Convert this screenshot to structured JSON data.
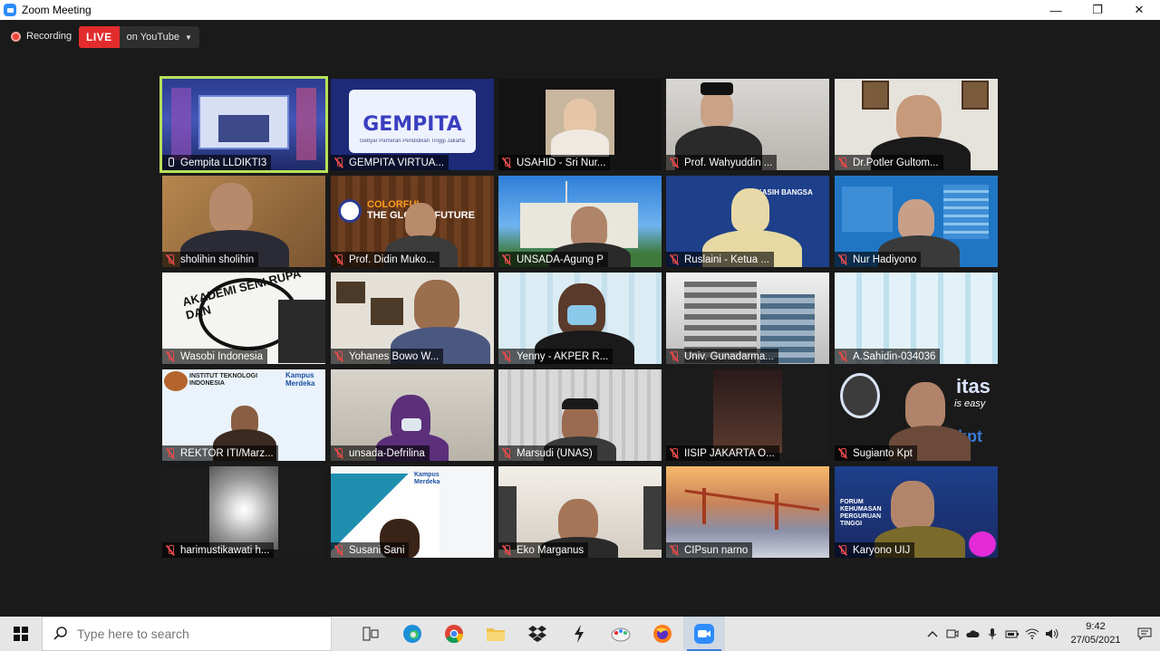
{
  "window": {
    "title": "Zoom Meeting",
    "minimize": "—",
    "maximize": "❐",
    "close": "✕"
  },
  "recording": {
    "label": "Recording"
  },
  "live": {
    "badge": "LIVE",
    "destination": "on YouTube"
  },
  "participants": [
    {
      "name": "Gempita LLDIKTI3",
      "muted": false,
      "active": true
    },
    {
      "name": "GEMPITA VIRTUA...",
      "muted": true
    },
    {
      "name": "USAHID - Sri Nur...",
      "muted": true
    },
    {
      "name": "Prof. Wahyuddin ...",
      "muted": true
    },
    {
      "name": "Dr.Potler Gultom...",
      "muted": true
    },
    {
      "name": "sholihin sholihin",
      "muted": true
    },
    {
      "name": "Prof. Didin Muko...",
      "muted": true
    },
    {
      "name": "UNSADA-Agung P",
      "muted": true
    },
    {
      "name": "Ruslaini - Ketua ...",
      "muted": true
    },
    {
      "name": "Nur Hadiyono",
      "muted": true
    },
    {
      "name": "Wasobi Indonesia",
      "muted": true
    },
    {
      "name": "Yohanes Bowo W...",
      "muted": true
    },
    {
      "name": "Yenny - AKPER  R...",
      "muted": true
    },
    {
      "name": "Univ. Gunadarma...",
      "muted": true
    },
    {
      "name": "A.Sahidin-034036",
      "muted": true
    },
    {
      "name": "REKTOR ITI/Marz...",
      "muted": true
    },
    {
      "name": "unsada-Defrilina",
      "muted": true
    },
    {
      "name": "Marsudi  (UNAS)",
      "muted": true
    },
    {
      "name": "IISIP JAKARTA O...",
      "muted": true
    },
    {
      "name": "Sugianto Kpt",
      "muted": true
    },
    {
      "name": "harimustikawati h...",
      "muted": true
    },
    {
      "name": "Susani Sani",
      "muted": true
    },
    {
      "name": "Eko Marganus",
      "muted": true
    },
    {
      "name": "CIPsun narno",
      "muted": true
    },
    {
      "name": "Karyono  UIJ",
      "muted": true
    }
  ],
  "tile_texts": {
    "gempita_logo": "GEMPITA",
    "gempita_sub": "Gebyar Pameran Pendidikan Tinggi Jakarta",
    "colorful": "COLORFUL",
    "global_future": "THE GLOBAL FUTURE",
    "kampus_merdeka": "Kampus Merdeka",
    "iti_name": "INSTITUT TEKNOLOGI INDONESIA",
    "forum_kehumasan": "FORUM KEHUMASAN PERGURUAN TINGGI",
    "akademi": "AKADEMI SENI RUPA DAN",
    "kasih_bangsa": "KASIH BANGSA",
    "kpt": "kpt",
    "itas": "itas",
    "easy": "is easy"
  },
  "taskbar": {
    "search_placeholder": "Type here to search",
    "time": "9:42",
    "date": "27/05/2021"
  },
  "colors": {
    "live_red": "#e22c2c",
    "active_speaker": "#b7e05a",
    "muted_red": "#e24a4a",
    "zoom_blue": "#2d8cff"
  }
}
